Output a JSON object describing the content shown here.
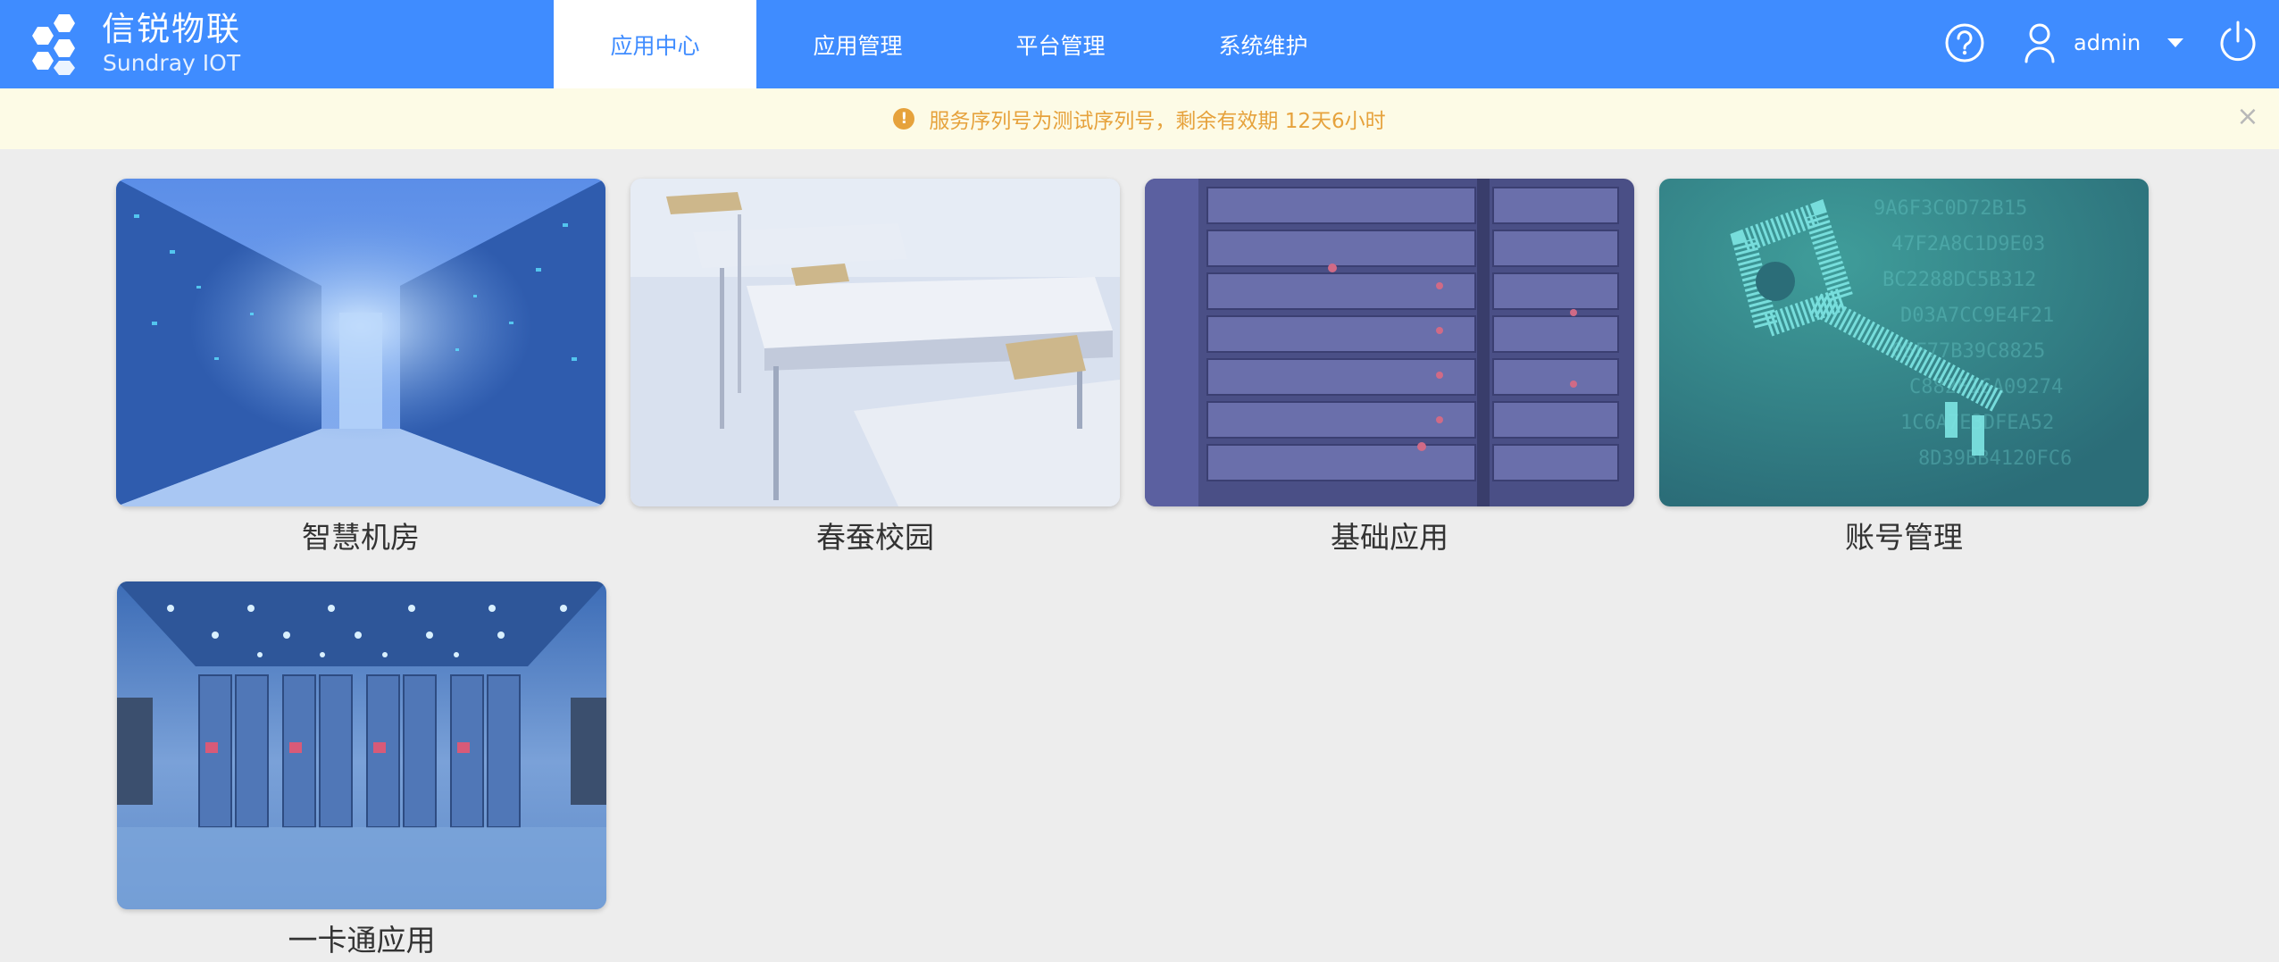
{
  "brand": {
    "name_cn": "信锐物联",
    "name_en": "Sundray IOT"
  },
  "nav": {
    "tabs": [
      {
        "label": "应用中心",
        "active": true
      },
      {
        "label": "应用管理",
        "active": false
      },
      {
        "label": "平台管理",
        "active": false
      },
      {
        "label": "系统维护",
        "active": false
      }
    ]
  },
  "header": {
    "help_icon": "question-circle-icon",
    "user_icon": "user-icon",
    "username": "admin",
    "dropdown_icon": "caret-down-icon",
    "power_icon": "power-icon"
  },
  "notice": {
    "icon": "warning-icon",
    "text": "服务序列号为测试序列号，剩余有效期 12天6小时",
    "close": "×"
  },
  "apps": [
    {
      "label": "智慧机房"
    },
    {
      "label": "春蚕校园"
    },
    {
      "label": "基础应用"
    },
    {
      "label": "账号管理"
    },
    {
      "label": "一卡通应用"
    }
  ],
  "colors": {
    "primary": "#3f8cff",
    "notice_bg": "#fdfbe6",
    "notice_text": "#e6a23c",
    "page_bg": "#ededed"
  }
}
